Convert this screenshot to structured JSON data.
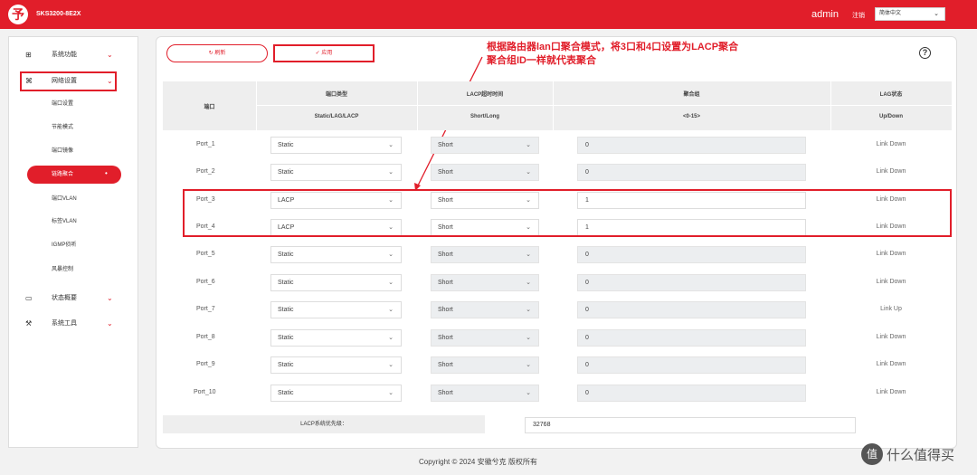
{
  "header": {
    "logo_glyph": "予",
    "model": "SKS3200-8E2X",
    "user": "admin",
    "logout": "注销",
    "language": "简体中文",
    "accent": "#e11e2a"
  },
  "sidebar": {
    "groups": [
      {
        "icon": "grid-icon",
        "label": "系统功能"
      },
      {
        "icon": "network-icon",
        "label": "网络设置"
      },
      {
        "icon": "monitor-icon",
        "label": "状态概要"
      },
      {
        "icon": "tools-icon",
        "label": "系统工具"
      }
    ],
    "sub_items": [
      "端口设置",
      "节能模式",
      "端口镜像",
      "链路聚合",
      "端口VLAN",
      "标签VLAN",
      "IGMP侦听",
      "风暴控制"
    ],
    "active_sub": "链路聚合"
  },
  "toolbar": {
    "refresh_label": "刷新",
    "apply_label": "应用"
  },
  "annotation": {
    "line1": "根据路由器lan口聚合模式，将3口和4口设置为LACP聚合",
    "line2": "聚合组ID一样就代表聚合"
  },
  "table": {
    "headers": {
      "port": "端口",
      "type": "端口类型",
      "type_sub": "Static/LAG/LACP",
      "lacp_timeout": "LACP超时时间",
      "lacp_timeout_sub": "Short/Long",
      "group": "聚合组",
      "group_sub": "<0-15>",
      "lag_status": "LAG状态",
      "lag_status_sub": "Up/Down"
    },
    "rows": [
      {
        "port": "Port_1",
        "type": "Static",
        "timeout": "Short",
        "group": "0",
        "status": "Link Down"
      },
      {
        "port": "Port_2",
        "type": "Static",
        "timeout": "Short",
        "group": "0",
        "status": "Link Down"
      },
      {
        "port": "Port_3",
        "type": "LACP",
        "timeout": "Short",
        "group": "1",
        "status": "Link Down"
      },
      {
        "port": "Port_4",
        "type": "LACP",
        "timeout": "Short",
        "group": "1",
        "status": "Link Down"
      },
      {
        "port": "Port_5",
        "type": "Static",
        "timeout": "Short",
        "group": "0",
        "status": "Link Down"
      },
      {
        "port": "Port_6",
        "type": "Static",
        "timeout": "Short",
        "group": "0",
        "status": "Link Down"
      },
      {
        "port": "Port_7",
        "type": "Static",
        "timeout": "Short",
        "group": "0",
        "status": "Link Up"
      },
      {
        "port": "Port_8",
        "type": "Static",
        "timeout": "Short",
        "group": "0",
        "status": "Link Down"
      },
      {
        "port": "Port_9",
        "type": "Static",
        "timeout": "Short",
        "group": "0",
        "status": "Link Down"
      },
      {
        "port": "Port_10",
        "type": "Static",
        "timeout": "Short",
        "group": "0",
        "status": "Link Down"
      }
    ]
  },
  "lacp_priority": {
    "label": "LACP系统优先级：",
    "value": "32768"
  },
  "footer": {
    "copyright": "Copyright © 2024 安徽兮克 版权所有"
  },
  "watermark": {
    "icon": "值",
    "text": "什么值得买"
  }
}
